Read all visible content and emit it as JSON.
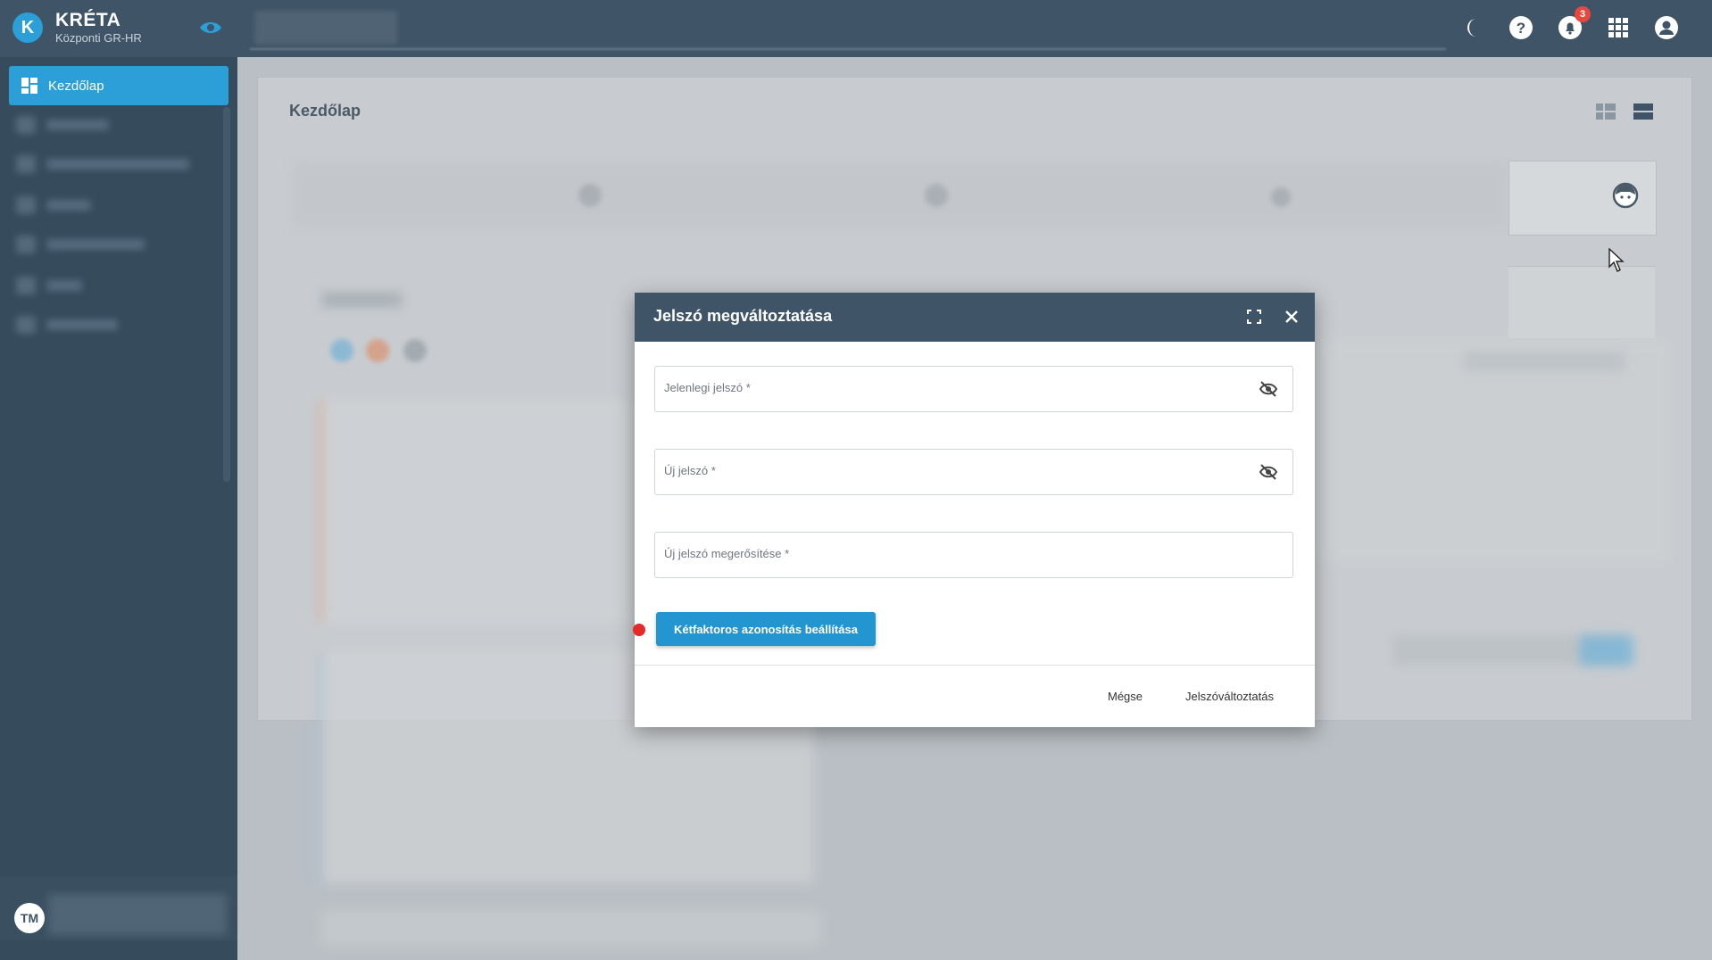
{
  "app": {
    "title": "KRÉTA",
    "subtitle": "Központi GR-HR",
    "logo_letter": "K",
    "accent_color": "#2c9fd9",
    "header_color": "#3f5466"
  },
  "topbar": {
    "icons": [
      "moon-icon",
      "help-icon",
      "bell-icon",
      "apps-grid-icon",
      "account-icon"
    ],
    "notification_count": "3"
  },
  "sidebar": {
    "active_item": {
      "label": "Kezdőlap",
      "icon": "dashboard-icon"
    },
    "user_initials": "TM"
  },
  "main": {
    "page_title": "Kezdőlap"
  },
  "dialog": {
    "title": "Jelszó megváltoztatása",
    "fields": {
      "current_password": {
        "label": "Jelenlegi jelszó *",
        "value": ""
      },
      "new_password": {
        "label": "Új jelszó *",
        "value": ""
      },
      "confirm_password": {
        "label": "Új jelszó megerősítése *",
        "value": ""
      }
    },
    "twofa_button": "Kétfaktoros azonosítás beállítása",
    "cancel_button": "Mégse",
    "submit_button": "Jelszóváltoztatás"
  }
}
